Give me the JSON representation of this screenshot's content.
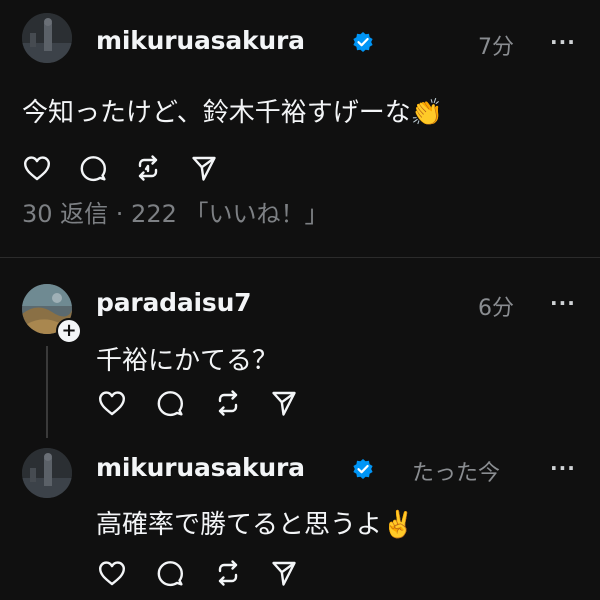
{
  "post": {
    "username": "mikuruasakura",
    "time": "7分",
    "text": "今知ったけど、鈴木千裕すげーな",
    "emoji": "👏",
    "stats": "30 返信 · 222 「いいね！」"
  },
  "reply1": {
    "username": "paradaisu7",
    "time": "6分",
    "text": "千裕にかてる？"
  },
  "reply2": {
    "username": "mikuruasakura",
    "time": "たった今",
    "text": "高確率で勝てると思うよ",
    "emoji": "✌️"
  },
  "more_glyph": "···",
  "colors": {
    "background": "#101010",
    "verified": "#0095f6",
    "secondary_text": "#8a8d91"
  },
  "icons": [
    "heart-icon",
    "comment-icon",
    "repost-icon",
    "share-icon",
    "verified-badge-icon",
    "more-icon",
    "follow-plus-icon"
  ]
}
